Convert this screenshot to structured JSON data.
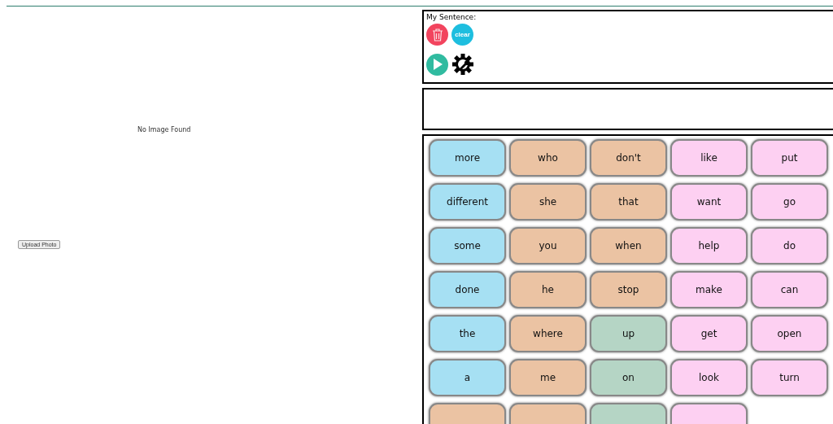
{
  "image_panel": {
    "message": "No Image Found",
    "upload_button": "Upload Photo"
  },
  "sentence_bar": {
    "label": "My Sentence:",
    "clear_button": "clear"
  },
  "tiles": [
    {
      "label": "more",
      "color": "#a6e0f3"
    },
    {
      "label": "who",
      "color": "#ebc3a3"
    },
    {
      "label": "don't",
      "color": "#ebc3a3"
    },
    {
      "label": "like",
      "color": "#fdd0f2"
    },
    {
      "label": "put",
      "color": "#fdd0f2"
    },
    {
      "label": "different",
      "color": "#a6e0f3"
    },
    {
      "label": "she",
      "color": "#ebc3a3"
    },
    {
      "label": "that",
      "color": "#ebc3a3"
    },
    {
      "label": "want",
      "color": "#fdd0f2"
    },
    {
      "label": "go",
      "color": "#fdd0f2"
    },
    {
      "label": "some",
      "color": "#a6e0f3"
    },
    {
      "label": "you",
      "color": "#ebc3a3"
    },
    {
      "label": "when",
      "color": "#ebc3a3"
    },
    {
      "label": "help",
      "color": "#fdd0f2"
    },
    {
      "label": "do",
      "color": "#fdd0f2"
    },
    {
      "label": "done",
      "color": "#a6e0f3"
    },
    {
      "label": "he",
      "color": "#ebc3a3"
    },
    {
      "label": "stop",
      "color": "#ebc3a3"
    },
    {
      "label": "make",
      "color": "#fdd0f2"
    },
    {
      "label": "can",
      "color": "#fdd0f2"
    },
    {
      "label": "the",
      "color": "#a6e0f3"
    },
    {
      "label": "where",
      "color": "#ebc3a3"
    },
    {
      "label": "up",
      "color": "#b5d5c5"
    },
    {
      "label": "get",
      "color": "#fdd0f2"
    },
    {
      "label": "open",
      "color": "#fdd0f2"
    },
    {
      "label": "a",
      "color": "#a6e0f3"
    },
    {
      "label": "me",
      "color": "#ebc3a3"
    },
    {
      "label": "on",
      "color": "#b5d5c5"
    },
    {
      "label": "look",
      "color": "#fdd0f2"
    },
    {
      "label": "turn",
      "color": "#fdd0f2"
    },
    {
      "color": "#ebc3a3"
    },
    {
      "color": "#ebc3a3"
    },
    {
      "color": "#b5d5c5"
    },
    {
      "color": "#fdd0f2"
    }
  ]
}
